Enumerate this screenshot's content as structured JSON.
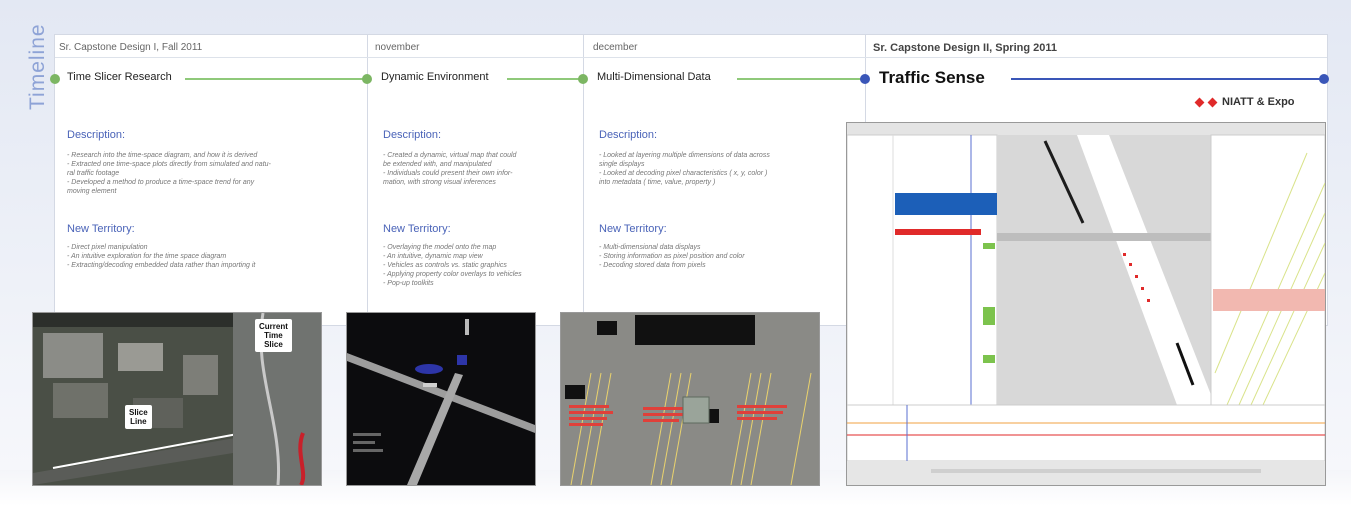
{
  "sidebar_title": "Timeline",
  "columns": [
    {
      "period": "Sr. Capstone Design I, Fall 2011",
      "milestone": "Time Slicer Research",
      "description_heading": "Description:",
      "description": [
        "- Research into the time-space diagram, and how it is derived",
        "- Extracted one time-space plots directly from simulated and natu-",
        "ral traffic footage",
        "- Developed a method to produce a time-space trend for any",
        "moving element"
      ],
      "territory_heading": "New Territory:",
      "territory": [
        "- Direct pixel manipulation",
        "- An intuitive exploration for the time space diagram",
        "- Extracting/decoding embedded data rather than importing it"
      ]
    },
    {
      "period": "november",
      "milestone": "Dynamic Environment",
      "description_heading": "Description:",
      "description": [
        "- Created a dynamic, virtual map that could",
        "be extended with, and manipulated",
        "- Individuals could present their own infor-",
        "mation, with strong visual inferences"
      ],
      "territory_heading": "New Territory:",
      "territory": [
        "- Overlaying the model onto the map",
        "- An intuitive, dynamic map view",
        "- Vehicles as controls vs. static graphics",
        "- Applying property color overlays to vehicles",
        "- Pop-up toolkits"
      ]
    },
    {
      "period": "december",
      "milestone": "Multi-Dimensional Data",
      "description_heading": "Description:",
      "description": [
        "- Looked at layering multiple dimensions of data across",
        "single displays",
        "- Looked at decoding pixel characteristics ( x, y, color )",
        "into metadata ( time, value, property )"
      ],
      "territory_heading": "New Territory:",
      "territory": [
        "- Multi-dimensional data displays",
        "- Storing information as pixel position and color",
        "- Decoding stored data from pixels"
      ]
    },
    {
      "period": "Sr. Capstone Design II, Spring 2011",
      "milestone": "Traffic Sense"
    }
  ],
  "expo_label": "NIATT & Expo",
  "screenshot_callouts": {
    "current_time_slice": "Current\nTime\nSlice",
    "slice_line": "Slice\nLine"
  },
  "colors": {
    "accent_blue": "#3a56b8",
    "timeline_green": "#7cb663",
    "heading_blue": "#4a63b8",
    "diamond_red": "#e02a2a"
  }
}
